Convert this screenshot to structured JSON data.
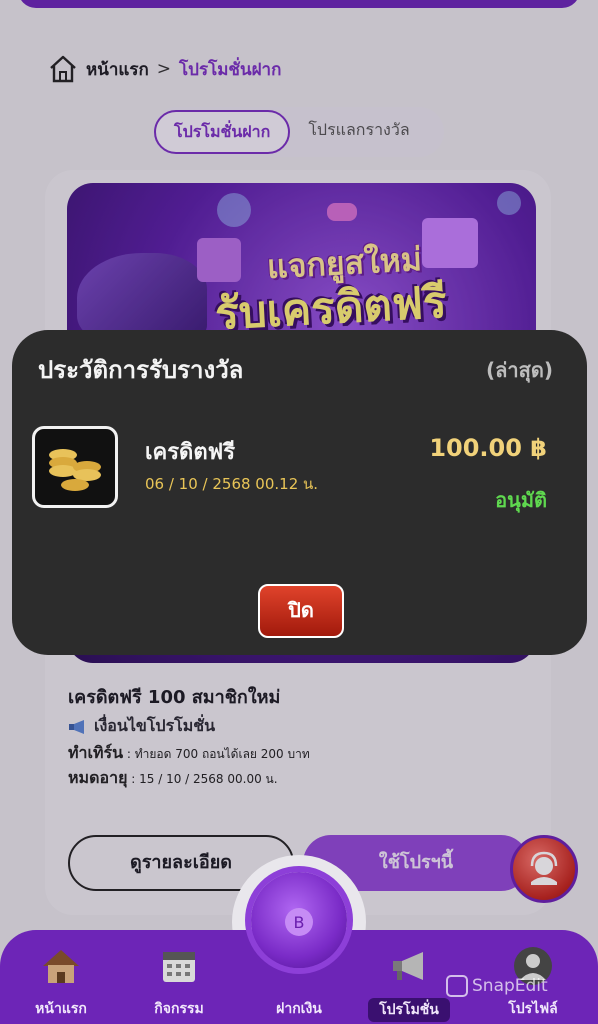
{
  "breadcrumb": {
    "home": "หน้าแรก",
    "separator": ">",
    "current": "โปรโมชั่นฝาก"
  },
  "tabs": [
    {
      "label": "โปรโมชั่นฝาก",
      "active": true
    },
    {
      "label": "โปรแลกรางวัล",
      "active": false
    }
  ],
  "banner": {
    "line1": "แจกยูสใหม่",
    "line2": "รับเครดิตฟรี"
  },
  "promo": {
    "title": "เครดิตฟรี 100 สมาชิกใหม่",
    "condition_label": "เงื่อนไขโปรโมชั่น",
    "turnover_label": "ทำเทิร์น",
    "turnover_value": " : ทำยอด 700 ถอนได้เลย 200 บาท",
    "expire_label": "หมดอายุ",
    "expire_value": " : 15 / 10 / 2568 00.00 น.",
    "detail_button": "ดูรายละเอียด",
    "use_button": "ใช้โปรฯนี้"
  },
  "modal": {
    "title": "ประวัติการรับรางวัล",
    "latest": "(ล่าสุด)",
    "item_name": "เครดิตฟรี",
    "item_date": "06 / 10 / 2568 00.12 น.",
    "amount": "100.00 ฿",
    "status": "อนุมัติ",
    "close_button": "ปิด"
  },
  "nav": [
    {
      "label": "หน้าแรก",
      "icon": "house-icon"
    },
    {
      "label": "กิจกรรม",
      "icon": "calendar-icon"
    },
    {
      "label": "ฝากเงิน",
      "icon": "deposit-coin-icon"
    },
    {
      "label": "โปรโมชั่น",
      "icon": "megaphone-icon",
      "active": true
    },
    {
      "label": "โปรไฟล์",
      "icon": "profile-icon"
    }
  ],
  "watermark": "SnapEdit",
  "colors": {
    "brand_purple": "#6d25b7",
    "accent_purple": "#7b2fc4",
    "status_green": "#5fd94f",
    "amount_gold": "#f1d27a",
    "close_red": "#c4241b"
  }
}
